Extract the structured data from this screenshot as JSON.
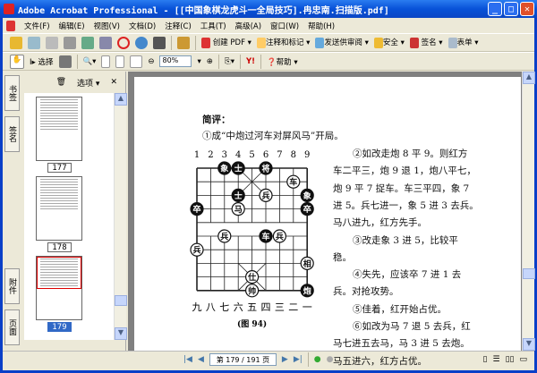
{
  "window": {
    "title": "Adobe Acrobat Professional - [[中国象棋龙虎斗一全局技巧].冉忠南.扫描版.pdf]"
  },
  "menu": [
    "文件(F)",
    "编辑(E)",
    "视图(V)",
    "文档(D)",
    "注释(C)",
    "工具(T)",
    "高级(A)",
    "窗口(W)",
    "帮助(H)"
  ],
  "toolbar1": {
    "create_pdf": "创建 PDF",
    "comment": "注释和标记",
    "review": "发送供审阅",
    "security": "安全",
    "sign": "签名",
    "forms": "表单"
  },
  "toolbar2": {
    "select": "选择",
    "zoom": "80%",
    "help": "帮助"
  },
  "side_tabs": [
    "书签",
    "签名",
    "附件",
    "页面"
  ],
  "panel": {
    "options": "选项",
    "thumbnails": [
      "177",
      "178",
      "179"
    ],
    "selected": "179"
  },
  "status": {
    "page": "第 179 / 191 页"
  },
  "colors": {
    "titlebar": "#0852d8",
    "selection": "#3169c6",
    "red_piece": "#b00000"
  },
  "doc": {
    "heading": "简评：",
    "lines_top": [
      "①成“中炮过河车对屏风马”开局。"
    ],
    "board_files_top": [
      "1",
      "2",
      "3",
      "4",
      "5",
      "6",
      "7",
      "8",
      "9"
    ],
    "board_files_bottom": [
      "九",
      "八",
      "七",
      "六",
      "五",
      "四",
      "三",
      "二",
      "一"
    ],
    "figure_caption": "(图 94)",
    "right_lines": [
      "②如改走炮 8 平 9。则红方",
      "车二平三，炮 9 退 1，炮八平七，",
      "炮 9 平 7 捉车。车三平四，象 7",
      "进 5。兵七进一，象 5 进 3 去兵。",
      "马八进九，红方先手。",
      "③改走象 3 进 5，比较平",
      "稳。",
      "④失先，应该卒 7 进 1 去",
      "兵。对抢攻势。",
      "⑤佳着，红开始占优。",
      "⑥如改为马 7 退 5 去兵，红",
      "马七进五去马，马 3 进 5 去炮。",
      "马五进六，红方占优。"
    ],
    "pieces": [
      {
        "c": 3,
        "r": 0,
        "t": "象",
        "side": "black"
      },
      {
        "c": 4,
        "r": 0,
        "t": "士",
        "side": "black"
      },
      {
        "c": 6,
        "r": 0,
        "t": "将",
        "side": "black"
      },
      {
        "c": 8,
        "r": 1,
        "t": "车",
        "side": "red"
      },
      {
        "c": 4,
        "r": 2,
        "t": "士",
        "side": "black"
      },
      {
        "c": 6,
        "r": 2,
        "t": "兵",
        "side": "red"
      },
      {
        "c": 9,
        "r": 2,
        "t": "象",
        "side": "black"
      },
      {
        "c": 1,
        "r": 3,
        "t": "卒",
        "side": "black"
      },
      {
        "c": 4,
        "r": 3,
        "t": "马",
        "side": "red"
      },
      {
        "c": 9,
        "r": 3,
        "t": "卒",
        "side": "black"
      },
      {
        "c": 3,
        "r": 5,
        "t": "兵",
        "side": "red"
      },
      {
        "c": 6,
        "r": 5,
        "t": "车",
        "side": "black"
      },
      {
        "c": 7,
        "r": 5,
        "t": "兵",
        "side": "red"
      },
      {
        "c": 1,
        "r": 6,
        "t": "兵",
        "side": "red"
      },
      {
        "c": 9,
        "r": 7,
        "t": "相",
        "side": "red"
      },
      {
        "c": 5,
        "r": 8,
        "t": "仕",
        "side": "red"
      },
      {
        "c": 5,
        "r": 9,
        "t": "帅",
        "side": "red"
      },
      {
        "c": 9,
        "r": 9,
        "t": "炮",
        "side": "black"
      }
    ]
  }
}
